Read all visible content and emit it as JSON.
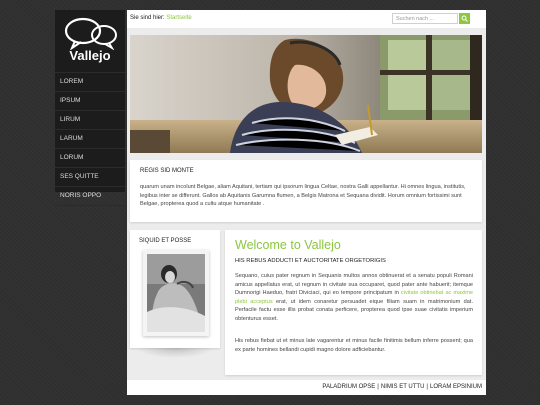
{
  "logo": {
    "text": "Vallejo"
  },
  "sidebar": {
    "items": [
      {
        "label": "LOREM"
      },
      {
        "label": "IPSUM"
      },
      {
        "label": "LIRUM"
      },
      {
        "label": "LARUM"
      },
      {
        "label": "LORUM"
      },
      {
        "label": "SES QUITTE"
      },
      {
        "label": "NORIS OPPO"
      }
    ]
  },
  "topbar": {
    "breadcrumb_prefix": "Sie sind hier:",
    "breadcrumb_link": "Startseite",
    "search_placeholder": "Suchen nach ..."
  },
  "intro": {
    "title": "REGIS SID MONTE",
    "text": "quarum unam incolunt Belgae, aliam Aquitani, tertiam qui ipsorum lingua Celtae, nostra Galli appellantur. Hi omnes lingua, institutis, legibus inter se differunt. Gallos ab Aquitanis Garumna flumen, a Belgis Matrona et Sequana dividit. Horum omnium fortissimi sunt Belgae, propterea quod a cultu atque humanitate ."
  },
  "left_box": {
    "title": "SIQUID ET POSSE"
  },
  "content": {
    "heading": "Welcome to Vallejo",
    "subheading": "HIS REBUS ADDUCTI ET AUCTORITATE ORGETORIGIS",
    "para1_a": "Sequano, cuius pater regnum in Sequanis multos annos obtinuerat et a senatu populi Romani amicus appellatus erat, ut regnum in civitate sua occuparet, quod pater ante habuerit; itemque Dumnorigi Haeduo, fratri Diviciaci, qui eo tempore principatum in ",
    "para1_link": "civitate obtinebat ac maxime plebi acceptus",
    "para1_b": " erat, ut idem conaretur persuadet eique filiam suam in matrimonium dat. Perfacile factu esse illis probat conata perficere, propterea quod ipse suae civitatis imperium obtenturus esset.",
    "para2": "His rebus fiebat ut et minus late vagarentur et minus facile finitimis bellum inferre possent; qua ex parte homines bellandi cupidi magno dolore adficiebantur."
  },
  "footer": {
    "links": [
      "PALADRIUM OPSE",
      "NIMIS ET UTTU",
      "LORAM EPSINIUM"
    ],
    "separator": "|"
  },
  "colors": {
    "accent": "#8dc63f",
    "sidebar": "#1c1c1c",
    "background": "#2f2f2f"
  },
  "icons": {
    "search": "search-icon",
    "logo": "speech-bubbles-icon"
  }
}
